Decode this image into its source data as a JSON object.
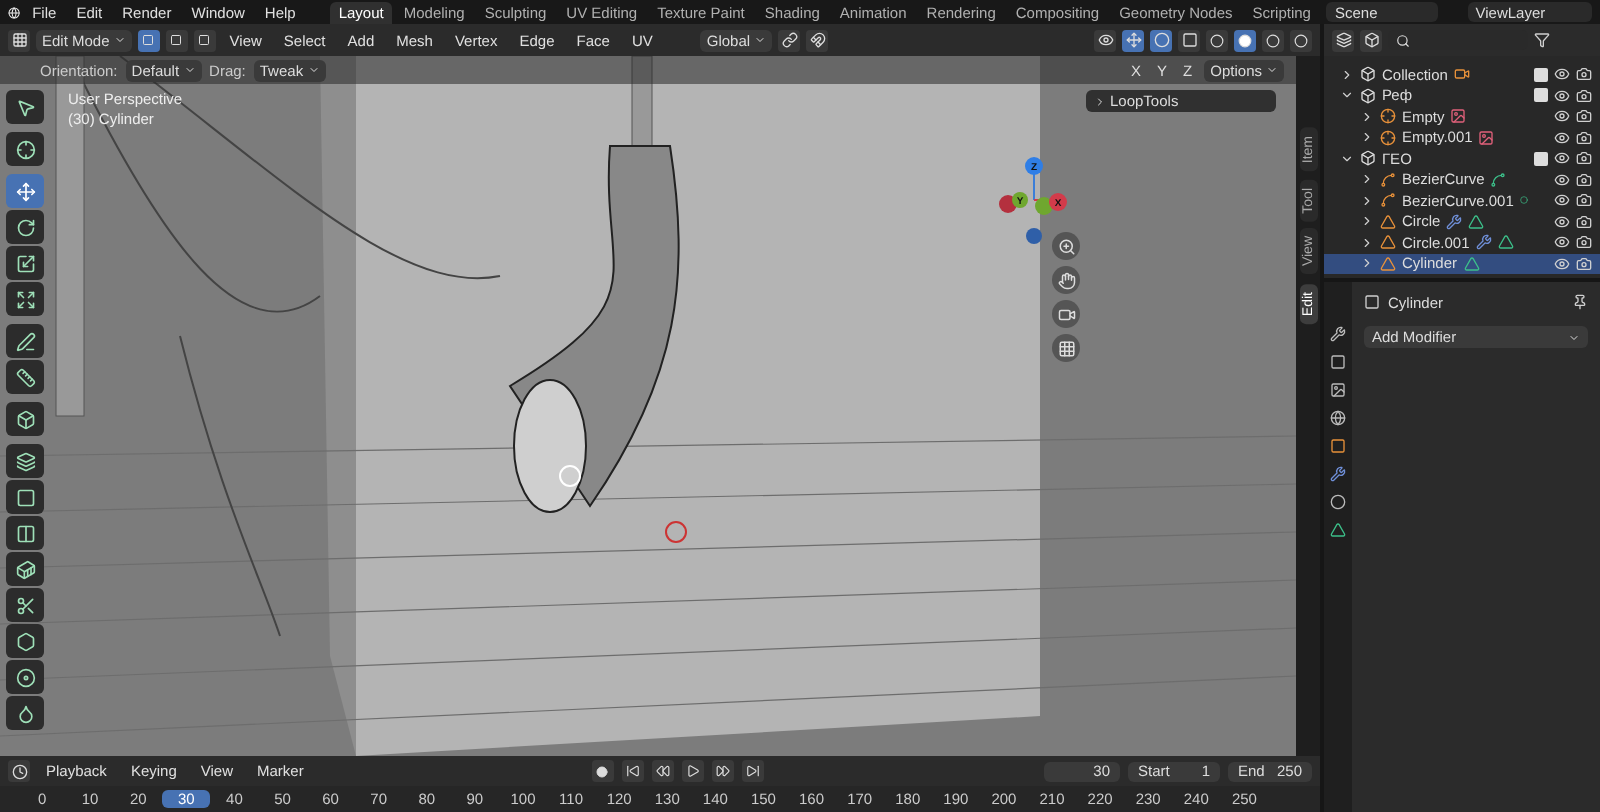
{
  "menu": [
    "File",
    "Edit",
    "Render",
    "Window",
    "Help"
  ],
  "workspaces": [
    {
      "label": "Layout",
      "selected": true
    },
    {
      "label": "Modeling",
      "selected": false
    },
    {
      "label": "Sculpting",
      "selected": false
    },
    {
      "label": "UV Editing",
      "selected": false
    },
    {
      "label": "Texture Paint",
      "selected": false
    },
    {
      "label": "Shading",
      "selected": false
    },
    {
      "label": "Animation",
      "selected": false
    },
    {
      "label": "Rendering",
      "selected": false
    },
    {
      "label": "Compositing",
      "selected": false
    },
    {
      "label": "Geometry Nodes",
      "selected": false
    },
    {
      "label": "Scripting",
      "selected": false
    }
  ],
  "scene": "Scene",
  "view_layer": "ViewLayer",
  "header": {
    "mode": "Edit Mode",
    "select_modes": [
      {
        "selected": true
      },
      {
        "selected": false
      },
      {
        "selected": false
      }
    ],
    "menus": [
      "View",
      "Select",
      "Add",
      "Mesh",
      "Vertex",
      "Edge",
      "Face",
      "UV"
    ],
    "orientation": "Global",
    "shading_modes": [
      {
        "selected": false
      },
      {
        "selected": true
      },
      {
        "selected": false
      },
      {
        "selected": false
      }
    ]
  },
  "tool_settings": {
    "orientation_label": "Orientation:",
    "orientation": "Default",
    "drag_label": "Drag:",
    "drag": "Tweak",
    "axes": [
      "X",
      "Y",
      "Z"
    ],
    "options": "Options"
  },
  "viewport": {
    "info": [
      "User Perspective",
      "(30) Cylinder"
    ],
    "panel": "LoopTools",
    "gizmo_axes": [
      "Z",
      "Y",
      "X"
    ],
    "side_tabs": [
      {
        "label": "Item",
        "selected": false
      },
      {
        "label": "Tool",
        "selected": false
      },
      {
        "label": "View",
        "selected": false
      },
      {
        "label": "Edit",
        "selected": true
      }
    ]
  },
  "tools": [
    {
      "kind": "select",
      "selected": false
    },
    {
      "kind": "cursor",
      "selected": false
    },
    {
      "kind": "move",
      "selected": true
    },
    {
      "kind": "rotate",
      "selected": false
    },
    {
      "kind": "scale",
      "selected": false
    },
    {
      "kind": "transform",
      "selected": false
    },
    {
      "kind": "annotate",
      "selected": false
    },
    {
      "kind": "measure",
      "selected": false
    },
    {
      "kind": "add-cube",
      "selected": false
    },
    {
      "kind": "extrude",
      "selected": false
    },
    {
      "kind": "inset",
      "selected": false
    },
    {
      "kind": "bevel",
      "selected": false
    },
    {
      "kind": "loop-cut",
      "selected": false
    },
    {
      "kind": "knife",
      "selected": false
    },
    {
      "kind": "poly-build",
      "selected": false
    },
    {
      "kind": "spin",
      "selected": false
    },
    {
      "kind": "smooth",
      "selected": false
    }
  ],
  "outliner": [
    {
      "label": "Collection",
      "kind": "collection",
      "expanded": false,
      "checked": true,
      "data": {
        "kind": "camera"
      }
    },
    {
      "label": "Реф",
      "kind": "collection",
      "expanded": true,
      "checked": true,
      "children": [
        {
          "label": "Empty",
          "kind": "empty",
          "selected": false,
          "data": {
            "kind": "image"
          }
        },
        {
          "label": "Empty.001",
          "kind": "empty",
          "selected": false,
          "data": {
            "kind": "image"
          }
        }
      ]
    },
    {
      "label": "ГЕО",
      "kind": "collection",
      "expanded": true,
      "checked": true,
      "children": [
        {
          "label": "BezierCurve",
          "kind": "curve",
          "selected": false,
          "data": {
            "kind": "curve"
          }
        },
        {
          "label": "BezierCurve.001",
          "kind": "curve",
          "selected": false,
          "data": {
            "kind": "dot"
          }
        },
        {
          "label": "Circle",
          "kind": "mesh",
          "selected": false,
          "data": {
            "kind": "modifier-mesh"
          }
        },
        {
          "label": "Circle.001",
          "kind": "mesh",
          "selected": false,
          "data": {
            "kind": "modifier-mesh"
          }
        },
        {
          "label": "Cylinder",
          "kind": "mesh",
          "selected": true,
          "data": {
            "kind": "mesh"
          }
        }
      ]
    }
  ],
  "properties": {
    "object": "Cylinder",
    "add_modifier": "Add Modifier"
  },
  "timeline": {
    "menus": [
      "Playback",
      "Keying",
      "View",
      "Marker"
    ],
    "current_frame": "30",
    "start_label": "Start",
    "start": "1",
    "end_label": "End",
    "end": "250",
    "ticks": [
      {
        "label": "0",
        "selected": false
      },
      {
        "label": "10",
        "selected": false
      },
      {
        "label": "20",
        "selected": false
      },
      {
        "label": "30",
        "selected": true
      },
      {
        "label": "40",
        "selected": false
      },
      {
        "label": "50",
        "selected": false
      },
      {
        "label": "60",
        "selected": false
      },
      {
        "label": "70",
        "selected": false
      },
      {
        "label": "80",
        "selected": false
      },
      {
        "label": "90",
        "selected": false
      },
      {
        "label": "100",
        "selected": false
      },
      {
        "label": "110",
        "selected": false
      },
      {
        "label": "120",
        "selected": false
      },
      {
        "label": "130",
        "selected": false
      },
      {
        "label": "140",
        "selected": false
      },
      {
        "label": "150",
        "selected": false
      },
      {
        "label": "160",
        "selected": false
      },
      {
        "label": "170",
        "selected": false
      },
      {
        "label": "180",
        "selected": false
      },
      {
        "label": "190",
        "selected": false
      },
      {
        "label": "200",
        "selected": false
      },
      {
        "label": "210",
        "selected": false
      },
      {
        "label": "220",
        "selected": false
      },
      {
        "label": "230",
        "selected": false
      },
      {
        "label": "240",
        "selected": false
      },
      {
        "label": "250",
        "selected": false
      }
    ]
  }
}
